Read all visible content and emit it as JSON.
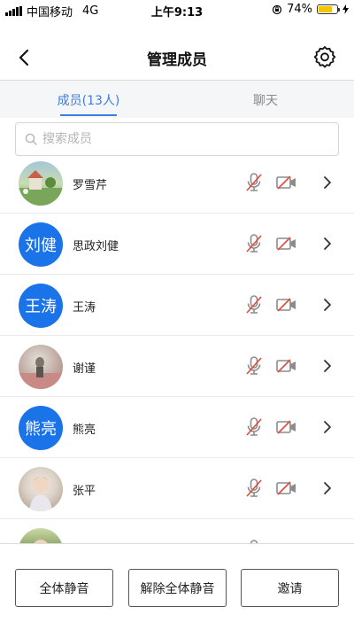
{
  "status_bar": {
    "carrier": "中国移动",
    "network": "4G",
    "time": "上午9:13",
    "battery_percent": "74%",
    "battery_level": 0.74,
    "battery_color": "#f5c400"
  },
  "nav": {
    "title": "管理成员",
    "back_icon": "chevron-left-icon",
    "settings_icon": "gear-icon"
  },
  "tabs": [
    {
      "label": "成员(13人)",
      "active": true
    },
    {
      "label": "聊天",
      "active": false
    }
  ],
  "search": {
    "placeholder": "搜索成员",
    "icon": "search-icon"
  },
  "members": [
    {
      "name": "罗雪芹",
      "avatar_text": "",
      "avatar_type": "photo",
      "mic": "muted",
      "camera": "off"
    },
    {
      "name": "思政刘健",
      "avatar_text": "刘健",
      "avatar_type": "initials",
      "mic": "muted",
      "camera": "off"
    },
    {
      "name": "王涛",
      "avatar_text": "王涛",
      "avatar_type": "initials",
      "mic": "muted",
      "camera": "off"
    },
    {
      "name": "谢谨",
      "avatar_text": "",
      "avatar_type": "photo",
      "mic": "muted",
      "camera": "off"
    },
    {
      "name": "熊亮",
      "avatar_text": "熊亮",
      "avatar_type": "initials",
      "mic": "muted",
      "camera": "off"
    },
    {
      "name": "张平",
      "avatar_text": "",
      "avatar_type": "photo",
      "mic": "muted",
      "camera": "off"
    },
    {
      "name": "",
      "avatar_text": "",
      "avatar_type": "photo",
      "mic": "unmuted",
      "camera": "off"
    }
  ],
  "buttons": {
    "mute_all": "全体静音",
    "unmute_all": "解除全体静音",
    "invite": "邀请"
  },
  "colors": {
    "accent": "#3b7de0",
    "avatar_blue": "#1a73e8",
    "muted_red": "#e04a3c"
  }
}
